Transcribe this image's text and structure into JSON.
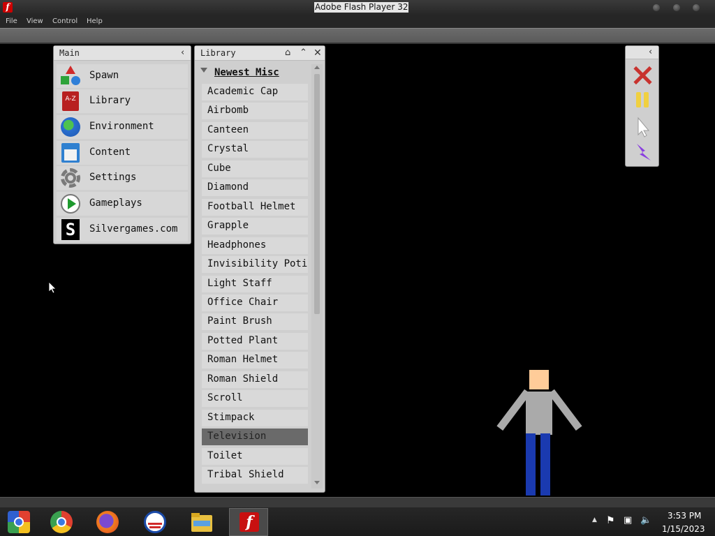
{
  "window": {
    "title": "Adobe Flash Player 32"
  },
  "menu": [
    "File",
    "View",
    "Control",
    "Help"
  ],
  "main_panel": {
    "title": "Main",
    "items": [
      {
        "label": "Spawn",
        "icon": "shapes-icon"
      },
      {
        "label": "Library",
        "icon": "book-icon",
        "icon_text": "A-Z"
      },
      {
        "label": "Environment",
        "icon": "globe-icon"
      },
      {
        "label": "Content",
        "icon": "floppy-icon"
      },
      {
        "label": "Settings",
        "icon": "gear-icon"
      },
      {
        "label": "Gameplays",
        "icon": "play-icon"
      },
      {
        "label": "Silvergames.com",
        "icon": "silvergames-logo-icon"
      }
    ]
  },
  "library_panel": {
    "title": "Library",
    "category": "Newest Misc",
    "items": [
      "Academic Cap",
      "Airbomb",
      "Canteen",
      "Crystal",
      "Cube",
      "Diamond",
      "Football Helmet",
      "Grapple",
      "Headphones",
      "Invisibility Potion",
      "Light Staff",
      "Office Chair",
      "Paint Brush",
      "Potted Plant",
      "Roman Helmet",
      "Roman Shield",
      "Scroll",
      "Stimpack",
      "Television",
      "Toilet",
      "Tribal Shield"
    ],
    "selected": "Television"
  },
  "tools": [
    "close-icon",
    "pause-icon",
    "cursor-icon",
    "lightning-icon"
  ],
  "taskbar": {
    "apps": [
      "chrome-remote-icon",
      "chrome-icon",
      "firefox-icon",
      "obama-logo-icon",
      "file-explorer-icon",
      "flash-player-icon"
    ],
    "time": "3:53 PM",
    "date": "1/15/2023"
  },
  "colors": {
    "accent_red": "#c8322e",
    "pause_yellow": "#f0d040",
    "lightning_purple": "#8a3ee0",
    "skin": "#ffcc99",
    "shirt": "#aaaaaa",
    "pants": "#1a3ab0"
  }
}
